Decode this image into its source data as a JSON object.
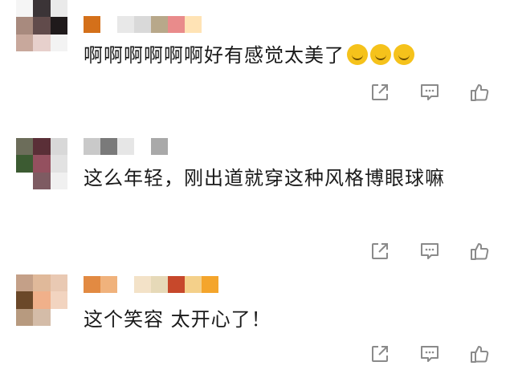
{
  "comments": [
    {
      "text": "啊啊啊啊啊啊好有感觉太美了",
      "emoji_count": 3,
      "emoji_icon": "crying-face-icon",
      "avatar_colors": [
        "#f5f5f5",
        "#3b3437",
        "#eaeaea",
        "#a88a7e",
        "#614b4b",
        "#1f1a1b",
        "#c8a89c",
        "#e7d0cc",
        "#f3f3f3"
      ],
      "name_colors": [
        "#d4701a",
        "#ffffff",
        "#e8e8e8",
        "#d9d9d9",
        "#b8a88a",
        "#e98b8b",
        "#ffe3b5"
      ]
    },
    {
      "text": "这么年轻，刚出道就穿这种风格博眼球嘛",
      "avatar_colors": [
        "#6c6d5a",
        "#5a2f37",
        "#d8d8d8",
        "#3c5b32",
        "#94505f",
        "#e2e2e2",
        "#ffffff",
        "#7e5b62",
        "#f0f0f0"
      ],
      "name_colors": [
        "#c9c9c9",
        "#7a7a7a",
        "#e6e6e6",
        "#ffffff",
        "#a9a9a9"
      ]
    },
    {
      "text": "这个笑容 太开心了！",
      "avatar_colors": [
        "#c4a088",
        "#e0b99a",
        "#e9c9b3",
        "#6b4829",
        "#f0b08a",
        "#f2d4c0",
        "#b79a7f",
        "#d4bca8",
        "#ffffff"
      ],
      "name_colors": [
        "#e28a42",
        "#f0b27c",
        "#ffffff",
        "#f3e2c8",
        "#e6d9b8",
        "#c7482b",
        "#f4d08a",
        "#f4a52c"
      ]
    }
  ],
  "actions": {
    "share_icon": "share-icon",
    "comment_icon": "comment-icon",
    "like_icon": "thumbs-up-icon",
    "icon_color": "#8a8a8a"
  }
}
